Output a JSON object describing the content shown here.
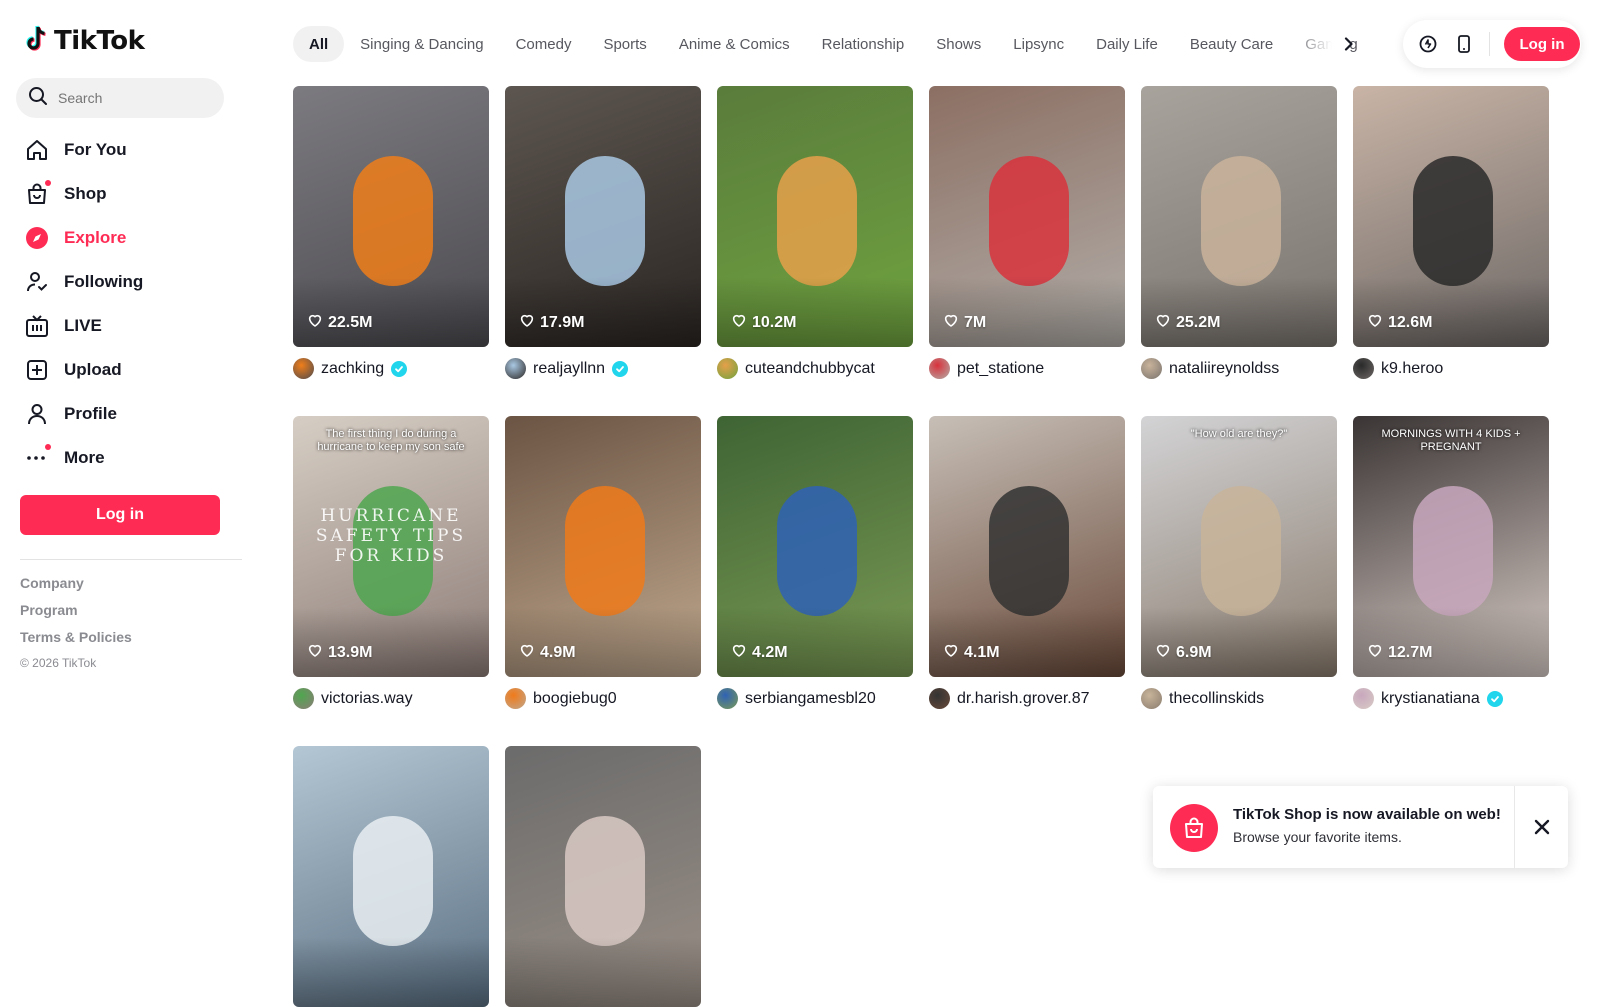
{
  "app": {
    "name": "TikTok"
  },
  "search": {
    "placeholder": "Search"
  },
  "nav": {
    "for_you": "For You",
    "shop": "Shop",
    "explore": "Explore",
    "following": "Following",
    "live": "LIVE",
    "upload": "Upload",
    "profile": "Profile",
    "more": "More"
  },
  "sidebar": {
    "login_label": "Log in",
    "footer": [
      "Company",
      "Program",
      "Terms & Policies"
    ],
    "copyright": "© 2026 TikTok"
  },
  "categories": [
    "All",
    "Singing & Dancing",
    "Comedy",
    "Sports",
    "Anime & Comics",
    "Relationship",
    "Shows",
    "Lipsync",
    "Daily Life",
    "Beauty Care",
    "Gaming"
  ],
  "header": {
    "login_label": "Log in"
  },
  "videos": [
    {
      "likes": "22.5M",
      "author": "zachking",
      "verified": true,
      "colors": [
        "#7c7b80",
        "#4b4a4f"
      ],
      "accent": "#f07e1a"
    },
    {
      "likes": "17.9M",
      "author": "realjayllnn",
      "verified": true,
      "colors": [
        "#5d5650",
        "#2a2522"
      ],
      "accent": "#a9c8e3"
    },
    {
      "likes": "10.2M",
      "author": "cuteandchubbycat",
      "verified": false,
      "colors": [
        "#5a7c3c",
        "#6fa33f"
      ],
      "accent": "#e6a04a"
    },
    {
      "likes": "7M",
      "author": "pet_statione",
      "verified": false,
      "colors": [
        "#8c6f63",
        "#b2aea9"
      ],
      "accent": "#d8323c"
    },
    {
      "likes": "25.2M",
      "author": "nataliireynoldss",
      "verified": false,
      "colors": [
        "#a8a39c",
        "#7a746e"
      ],
      "accent": "#c9b39b"
    },
    {
      "likes": "12.6M",
      "author": "k9.heroo",
      "verified": false,
      "colors": [
        "#c9b4a6",
        "#6d6866"
      ],
      "accent": "#2a2a2a"
    },
    {
      "likes": "13.9M",
      "author": "victorias.way",
      "verified": false,
      "colors": [
        "#d6cec4",
        "#8d7c77"
      ],
      "accent": "#4fa64f",
      "overlay": "The first thing I do during a hurricane to keep my son safe",
      "overlay_big": "HURRICANE SAFETY TIPS FOR KIDS"
    },
    {
      "likes": "4.9M",
      "author": "boogiebug0",
      "verified": false,
      "colors": [
        "#6b5443",
        "#c0a88e"
      ],
      "accent": "#f07a1a"
    },
    {
      "likes": "4.2M",
      "author": "serbiangamesbl20",
      "verified": false,
      "colors": [
        "#3f6434",
        "#7a9a54"
      ],
      "accent": "#2f62b5"
    },
    {
      "likes": "4.1M",
      "author": "dr.harish.grover.87",
      "verified": false,
      "colors": [
        "#c7bfb7",
        "#6a4a3a"
      ],
      "accent": "#333"
    },
    {
      "likes": "6.9M",
      "author": "thecollinskids",
      "verified": false,
      "colors": [
        "#d3d3d5",
        "#8a7c6e"
      ],
      "accent": "#c8b49a",
      "overlay": "\"How old are they?\""
    },
    {
      "likes": "12.7M",
      "author": "krystianatiana",
      "verified": true,
      "colors": [
        "#3a3434",
        "#d8ccc6"
      ],
      "accent": "#c8a7bd",
      "overlay": "MORNINGS WITH 4 KIDS + PREGNANT"
    },
    {
      "likes": "",
      "author": "",
      "verified": false,
      "colors": [
        "#b4c7d4",
        "#5b7083"
      ],
      "accent": "#e9eef2"
    },
    {
      "likes": "",
      "author": "",
      "verified": false,
      "colors": [
        "#6b6b6b",
        "#9a8f86"
      ],
      "accent": "#d9c9c4"
    }
  ],
  "toast": {
    "title": "TikTok Shop is now available on web!",
    "subtitle": "Browse your favorite items."
  },
  "theme": {
    "brand": "#fe2c55",
    "verified": "#20d5ec"
  }
}
